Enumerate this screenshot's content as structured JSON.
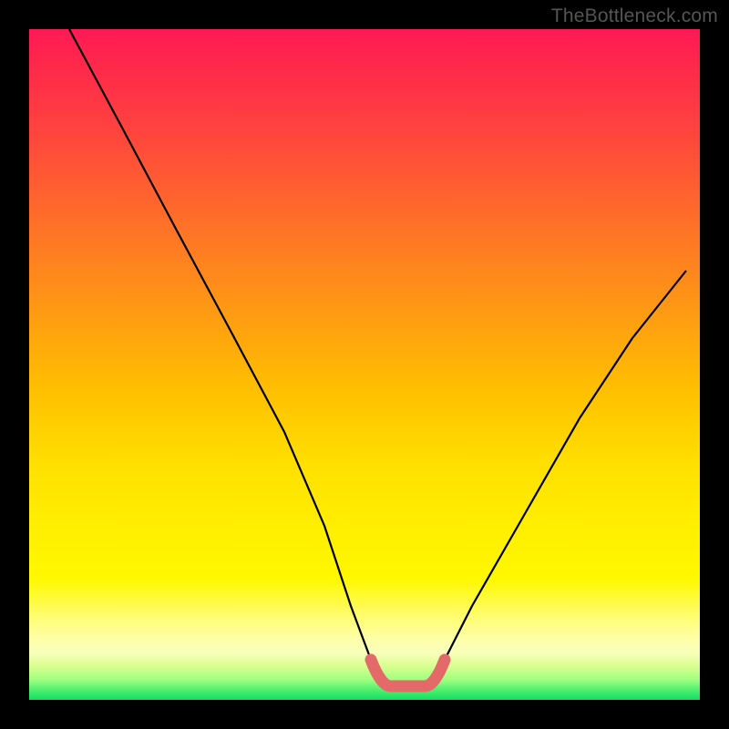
{
  "watermark": {
    "text": "TheBottleneck.com"
  },
  "chart_data": {
    "type": "line",
    "title": "",
    "xlabel": "",
    "ylabel": "",
    "xlim": [
      0,
      100
    ],
    "ylim": [
      0,
      100
    ],
    "series": [
      {
        "name": "bottleneck-curve",
        "x": [
          6,
          14,
          22,
          30,
          38,
          44,
          48,
          51,
          54,
          56,
          59,
          62,
          66,
          74,
          82,
          90,
          98
        ],
        "y": [
          100,
          85,
          70,
          55,
          40,
          26,
          14,
          6,
          2,
          2,
          2,
          6,
          14,
          28,
          42,
          54,
          64
        ]
      }
    ],
    "highlight": {
      "name": "min-segment",
      "x": [
        51,
        54,
        56,
        59,
        62
      ],
      "y": [
        6,
        2,
        2,
        2,
        6
      ],
      "color": "#e46a6a"
    },
    "background": {
      "type": "vertical-gradient",
      "stops": [
        {
          "pos": 0.0,
          "color": "#ff1a55"
        },
        {
          "pos": 0.5,
          "color": "#ffc000"
        },
        {
          "pos": 0.85,
          "color": "#ffff80"
        },
        {
          "pos": 1.0,
          "color": "#10e060"
        }
      ]
    }
  }
}
